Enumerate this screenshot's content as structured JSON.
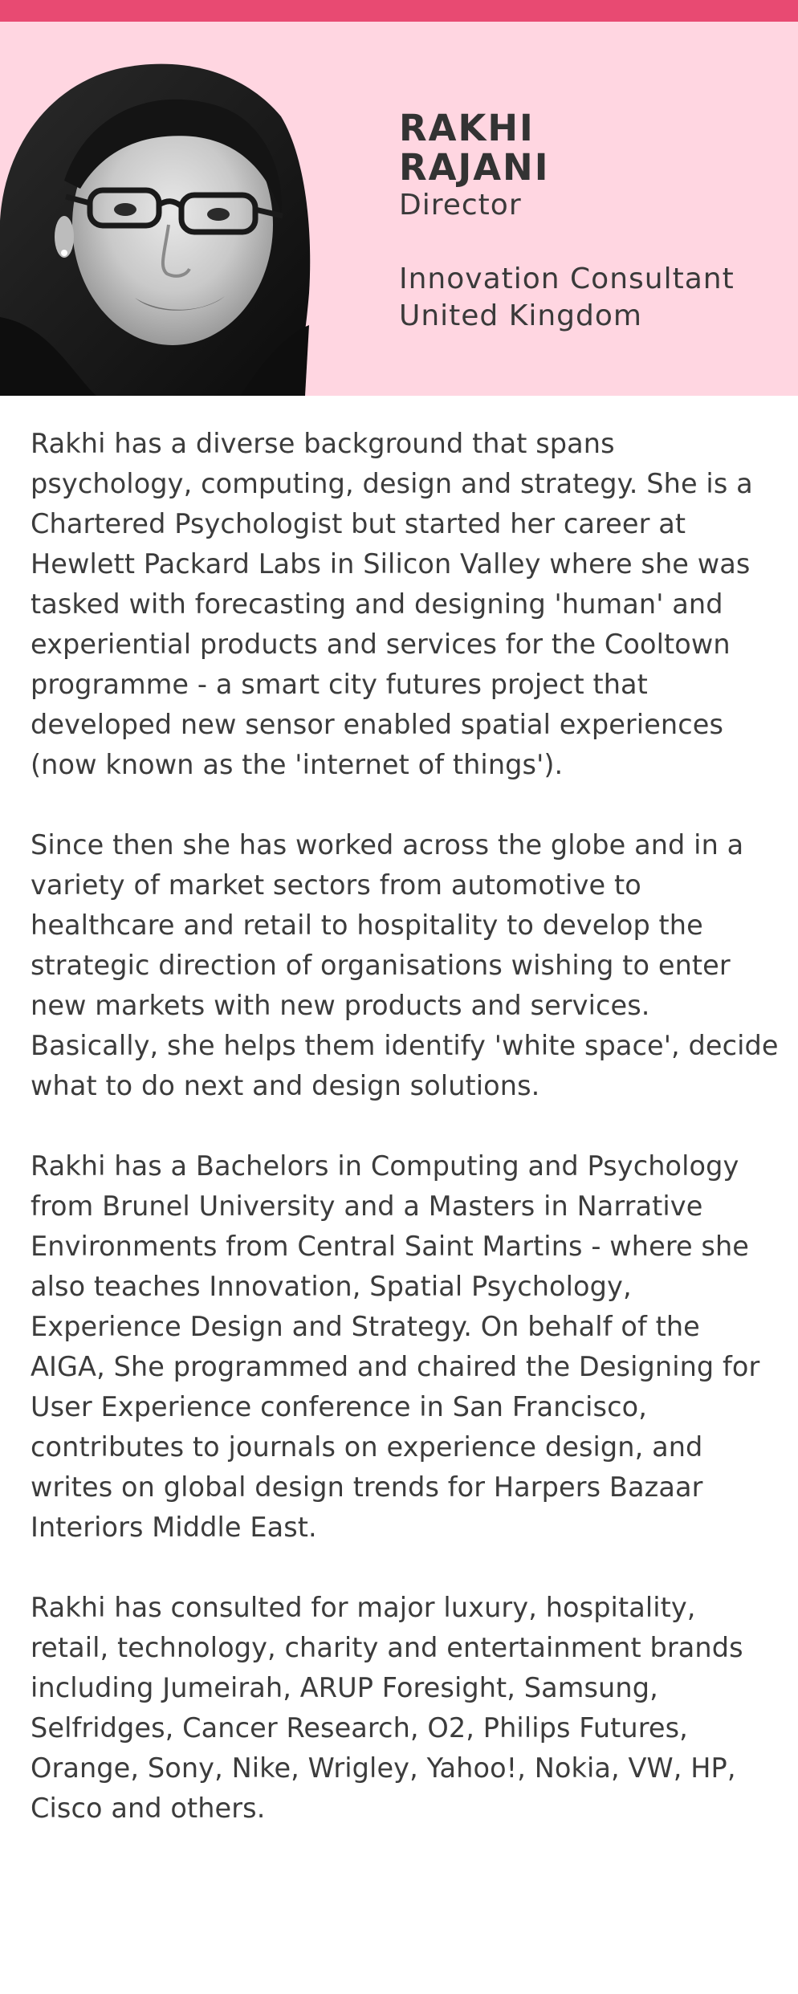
{
  "profile": {
    "name_line1": "RAKHI",
    "name_line2": "RAJANI",
    "title": "Director",
    "role": "Innovation Consultant",
    "location": "United Kingdom",
    "portrait": "portrait-photo"
  },
  "colors": {
    "accent_bar": "#e84a72",
    "header_bg": "#ffd6e1",
    "text": "#3c3c3c"
  },
  "bio": {
    "paragraphs": [
      "Rakhi has a diverse background that spans psychology, computing, design and strategy. She is a Chartered Psychologist but started her career at Hewlett Packard Labs in Silicon Valley where she was tasked with forecasting and designing 'human' and experiential products and services for the Cooltown programme - a smart city futures project that developed new sensor enabled spatial experiences (now known as the 'internet of things').",
      "Since then she has worked across the globe and in a variety of market sectors from automotive to healthcare and retail to hospitality to develop the strategic direction of organisations wishing to enter new markets with new products and services. Basically, she helps them identify 'white space', decide what to do next and design solutions.",
      "Rakhi has a Bachelors in Computing and Psychology from Brunel University and a Masters in Narrative Environments from Central Saint Martins - where she also teaches Innovation, Spatial Psychology, Experience Design and Strategy. On behalf of the AIGA, She programmed and chaired the Designing for User Experience conference in San Francisco, contributes to journals on experience design, and writes on global design trends for Harpers Bazaar Interiors Middle East.",
      "Rakhi has consulted for major luxury, hospitality, retail, technology, charity and entertainment brands including Jumeirah, ARUP Foresight, Samsung, Selfridges, Cancer Research, O2, Philips Futures, Orange, Sony, Nike, Wrigley, Yahoo!, Nokia, VW, HP, Cisco and others."
    ]
  }
}
